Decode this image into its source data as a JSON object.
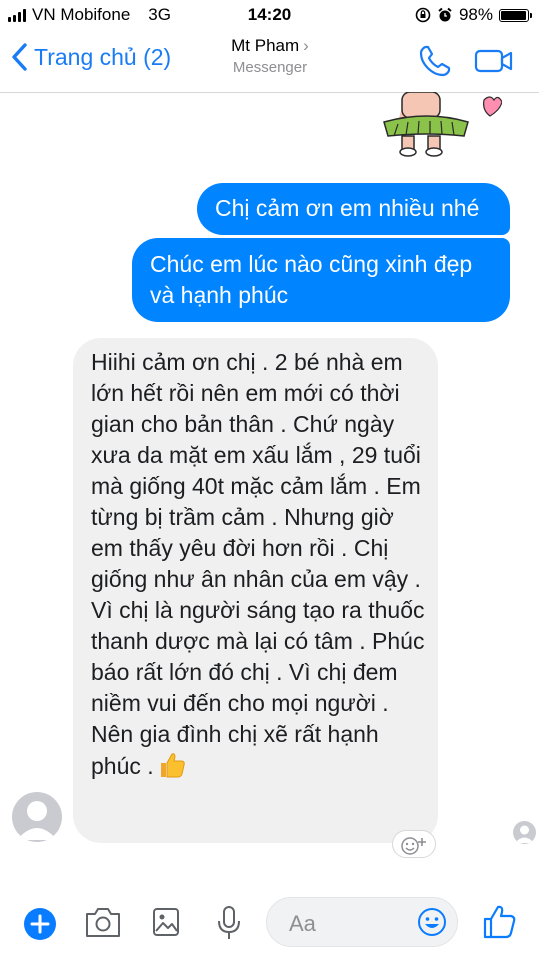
{
  "status_bar": {
    "carrier": "VN Mobifone",
    "network": "3G",
    "time": "14:20",
    "battery": "98%",
    "battery_level": 0.98
  },
  "nav": {
    "back_label": "Trang chủ (2)",
    "contact_name": "Mt Pham",
    "subtitle": "Messenger",
    "chevron": "›",
    "call_icon": "phone-icon",
    "video_icon": "video-camera-icon"
  },
  "messages": [
    {
      "direction": "outgoing",
      "text": "Chị cảm ơn em nhiều nhé"
    },
    {
      "direction": "outgoing",
      "text": "Chúc em lúc nào cũng xinh đẹp và hạnh phúc"
    },
    {
      "direction": "incoming",
      "text": "Hiihi cảm ơn chị . 2 bé nhà em lớn hết rồi nên em mới có thời gian cho bản thân . Chứ ngày xưa da mặt em xấu lắm , 29 tuổi mà giống 40t mặc cảm lắm . Em từng bị trầm cảm . Nhưng giờ em thấy yêu đời hơn rồi . Chị giống như ân nhân của em vậy . Vì chị là người sáng tạo ra thuốc thanh dược mà lại có tâm . Phúc báo rất lớn đó chị . Vì chị đem niềm vui đến cho mọi người . Nên gia đình chị xẽ rất hạnh phúc .",
      "emoji": "thumbs-up-icon"
    }
  ],
  "composer": {
    "placeholder": "Aa",
    "icons": [
      "plus-icon",
      "camera-icon",
      "image-icon",
      "microphone-icon",
      "emoji-icon",
      "like-icon"
    ]
  },
  "colors": {
    "accent": "#0084ff",
    "incoming_bubble": "#f1f0f0",
    "nav_link": "#1a7cf5"
  }
}
